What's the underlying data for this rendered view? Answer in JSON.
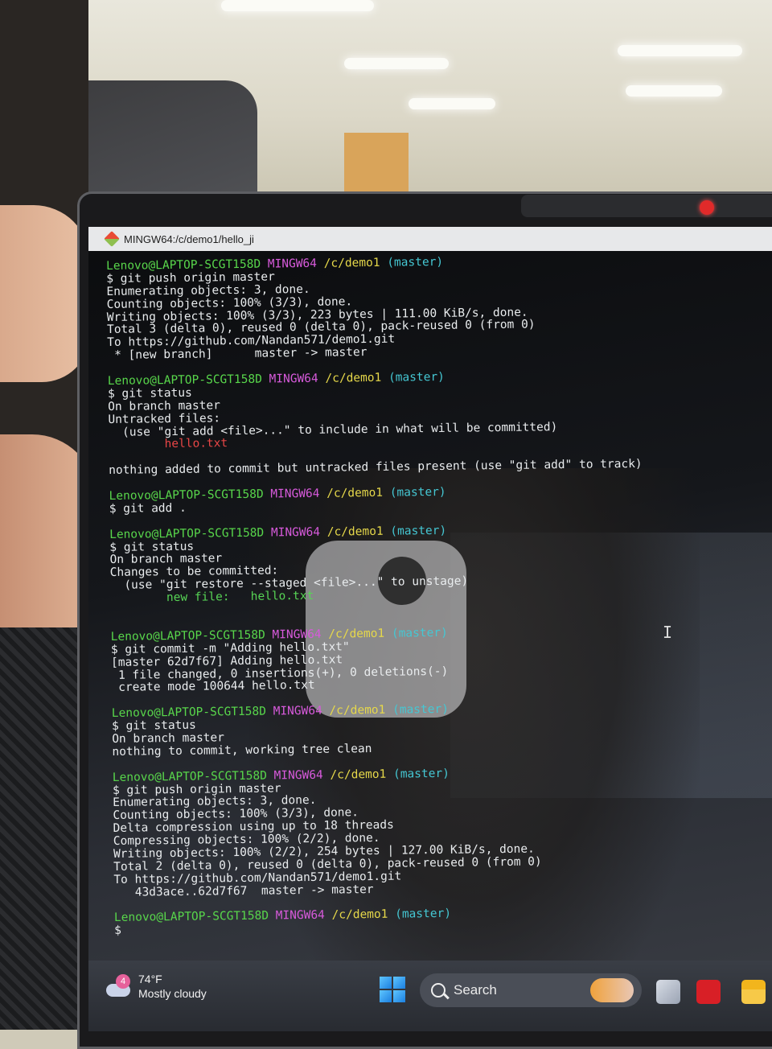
{
  "window": {
    "title": "MINGW64:/c/demo1/hello_ji"
  },
  "terminal": {
    "lines": [
      [
        {
          "t": "Lenovo@LAPTOP-SCGT158D",
          "c": "u"
        },
        {
          "t": " "
        },
        {
          "t": "MINGW64",
          "c": "m"
        },
        {
          "t": " "
        },
        {
          "t": "/c/demo1",
          "c": "p"
        },
        {
          "t": " "
        },
        {
          "t": "(master)",
          "c": "b"
        }
      ],
      [
        {
          "t": "$ git push origin master"
        }
      ],
      [
        {
          "t": "Enumerating objects: 3, done."
        }
      ],
      [
        {
          "t": "Counting objects: 100% (3/3), done."
        }
      ],
      [
        {
          "t": "Writing objects: 100% (3/3), 223 bytes | 111.00 KiB/s, done."
        }
      ],
      [
        {
          "t": "Total 3 (delta 0), reused 0 (delta 0), pack-reused 0 (from 0)"
        }
      ],
      [
        {
          "t": "To https://github.com/Nandan571/demo1.git"
        }
      ],
      [
        {
          "t": " * [new branch]      master -> master"
        }
      ],
      [],
      [
        {
          "t": "Lenovo@LAPTOP-SCGT158D",
          "c": "u"
        },
        {
          "t": " "
        },
        {
          "t": "MINGW64",
          "c": "m"
        },
        {
          "t": " "
        },
        {
          "t": "/c/demo1",
          "c": "p"
        },
        {
          "t": " "
        },
        {
          "t": "(master)",
          "c": "b"
        }
      ],
      [
        {
          "t": "$ git status"
        }
      ],
      [
        {
          "t": "On branch master"
        }
      ],
      [
        {
          "t": "Untracked files:"
        }
      ],
      [
        {
          "t": "  (use \"git add <file>...\" to include in what will be committed)"
        }
      ],
      [
        {
          "t": "        "
        },
        {
          "t": "hello.txt",
          "c": "r"
        }
      ],
      [],
      [
        {
          "t": "nothing added to commit but untracked files present (use \"git add\" to track)"
        }
      ],
      [],
      [
        {
          "t": "Lenovo@LAPTOP-SCGT158D",
          "c": "u"
        },
        {
          "t": " "
        },
        {
          "t": "MINGW64",
          "c": "m"
        },
        {
          "t": " "
        },
        {
          "t": "/c/demo1",
          "c": "p"
        },
        {
          "t": " "
        },
        {
          "t": "(master)",
          "c": "b"
        }
      ],
      [
        {
          "t": "$ git add ."
        }
      ],
      [],
      [
        {
          "t": "Lenovo@LAPTOP-SCGT158D",
          "c": "u"
        },
        {
          "t": " "
        },
        {
          "t": "MINGW64",
          "c": "m"
        },
        {
          "t": " "
        },
        {
          "t": "/c/demo1",
          "c": "p"
        },
        {
          "t": " "
        },
        {
          "t": "(master)",
          "c": "b"
        }
      ],
      [
        {
          "t": "$ git status"
        }
      ],
      [
        {
          "t": "On branch master"
        }
      ],
      [
        {
          "t": "Changes to be committed:"
        }
      ],
      [
        {
          "t": "  (use \"git restore --staged <file>...\" to unstage)"
        }
      ],
      [
        {
          "t": "        "
        },
        {
          "t": "new file:   hello.txt",
          "c": "g"
        }
      ],
      [],
      [],
      [
        {
          "t": "Lenovo@LAPTOP-SCGT158D",
          "c": "u"
        },
        {
          "t": " "
        },
        {
          "t": "MINGW64",
          "c": "m"
        },
        {
          "t": " "
        },
        {
          "t": "/c/demo1",
          "c": "p"
        },
        {
          "t": " "
        },
        {
          "t": "(master)",
          "c": "b"
        }
      ],
      [
        {
          "t": "$ git commit -m \"Adding hello.txt\""
        }
      ],
      [
        {
          "t": "[master 62d7f67] Adding hello.txt"
        }
      ],
      [
        {
          "t": " 1 file changed, 0 insertions(+), 0 deletions(-)"
        }
      ],
      [
        {
          "t": " create mode 100644 hello.txt"
        }
      ],
      [],
      [
        {
          "t": "Lenovo@LAPTOP-SCGT158D",
          "c": "u"
        },
        {
          "t": " "
        },
        {
          "t": "MINGW64",
          "c": "m"
        },
        {
          "t": " "
        },
        {
          "t": "/c/demo1",
          "c": "p"
        },
        {
          "t": " "
        },
        {
          "t": "(master)",
          "c": "b"
        }
      ],
      [
        {
          "t": "$ git status"
        }
      ],
      [
        {
          "t": "On branch master"
        }
      ],
      [
        {
          "t": "nothing to commit, working tree clean"
        }
      ],
      [],
      [
        {
          "t": "Lenovo@LAPTOP-SCGT158D",
          "c": "u"
        },
        {
          "t": " "
        },
        {
          "t": "MINGW64",
          "c": "m"
        },
        {
          "t": " "
        },
        {
          "t": "/c/demo1",
          "c": "p"
        },
        {
          "t": " "
        },
        {
          "t": "(master)",
          "c": "b"
        }
      ],
      [
        {
          "t": "$ git push origin master"
        }
      ],
      [
        {
          "t": "Enumerating objects: 3, done."
        }
      ],
      [
        {
          "t": "Counting objects: 100% (3/3), done."
        }
      ],
      [
        {
          "t": "Delta compression using up to 18 threads"
        }
      ],
      [
        {
          "t": "Compressing objects: 100% (2/2), done."
        }
      ],
      [
        {
          "t": "Writing objects: 100% (2/2), 254 bytes | 127.00 KiB/s, done."
        }
      ],
      [
        {
          "t": "Total 2 (delta 0), reused 0 (delta 0), pack-reused 0 (from 0)"
        }
      ],
      [
        {
          "t": "To https://github.com/Nandan571/demo1.git"
        }
      ],
      [
        {
          "t": "   43d3ace..62d7f67  master -> master"
        }
      ],
      [],
      [
        {
          "t": "Lenovo@LAPTOP-SCGT158D",
          "c": "u"
        },
        {
          "t": " "
        },
        {
          "t": "MINGW64",
          "c": "m"
        },
        {
          "t": " "
        },
        {
          "t": "/c/demo1",
          "c": "p"
        },
        {
          "t": " "
        },
        {
          "t": "(master)",
          "c": "b"
        }
      ],
      [
        {
          "t": "$"
        }
      ]
    ]
  },
  "taskbar": {
    "weather": {
      "badge": "4",
      "temp": "74°F",
      "condition": "Mostly cloudy",
      "icon": "cloud-icon"
    },
    "search": {
      "label": "Search",
      "icon": "search-icon"
    },
    "icons": [
      "windows-start-icon",
      "task-view-icon",
      "mcafee-icon",
      "file-explorer-icon"
    ]
  },
  "colors": {
    "user_host": "#58d64b",
    "mingw": "#d75adb",
    "path": "#e6d84a",
    "branch": "#45c7d3",
    "untracked": "#e84646",
    "staged": "#57d455",
    "accent_red": "#e02a2a"
  }
}
